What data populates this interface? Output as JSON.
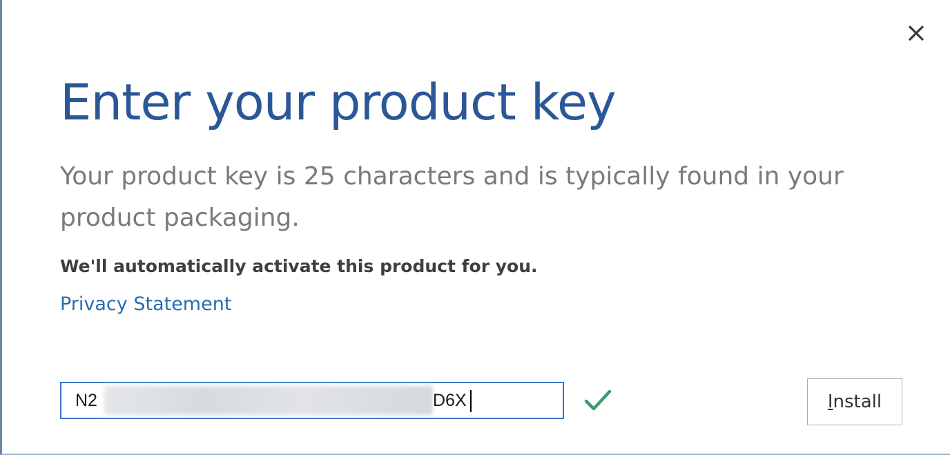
{
  "dialog": {
    "close_icon": "close-icon",
    "title": "Enter your product key",
    "description": "Your product key is 25 characters and is typically found in your product packaging.",
    "auto_activate_note": "We'll automatically activate this product for you.",
    "privacy_link_label": "Privacy Statement"
  },
  "product_key": {
    "visible_prefix": "N2",
    "visible_suffix": "D6X",
    "obscured": true,
    "valid_icon": "checkmark-icon",
    "valid_color": "#3a9a6b"
  },
  "install_button": {
    "mnemonic": "I",
    "label_rest": "nstall"
  },
  "colors": {
    "title": "#2b5797",
    "link": "#2a6bb0",
    "input_border": "#3c78c2"
  }
}
